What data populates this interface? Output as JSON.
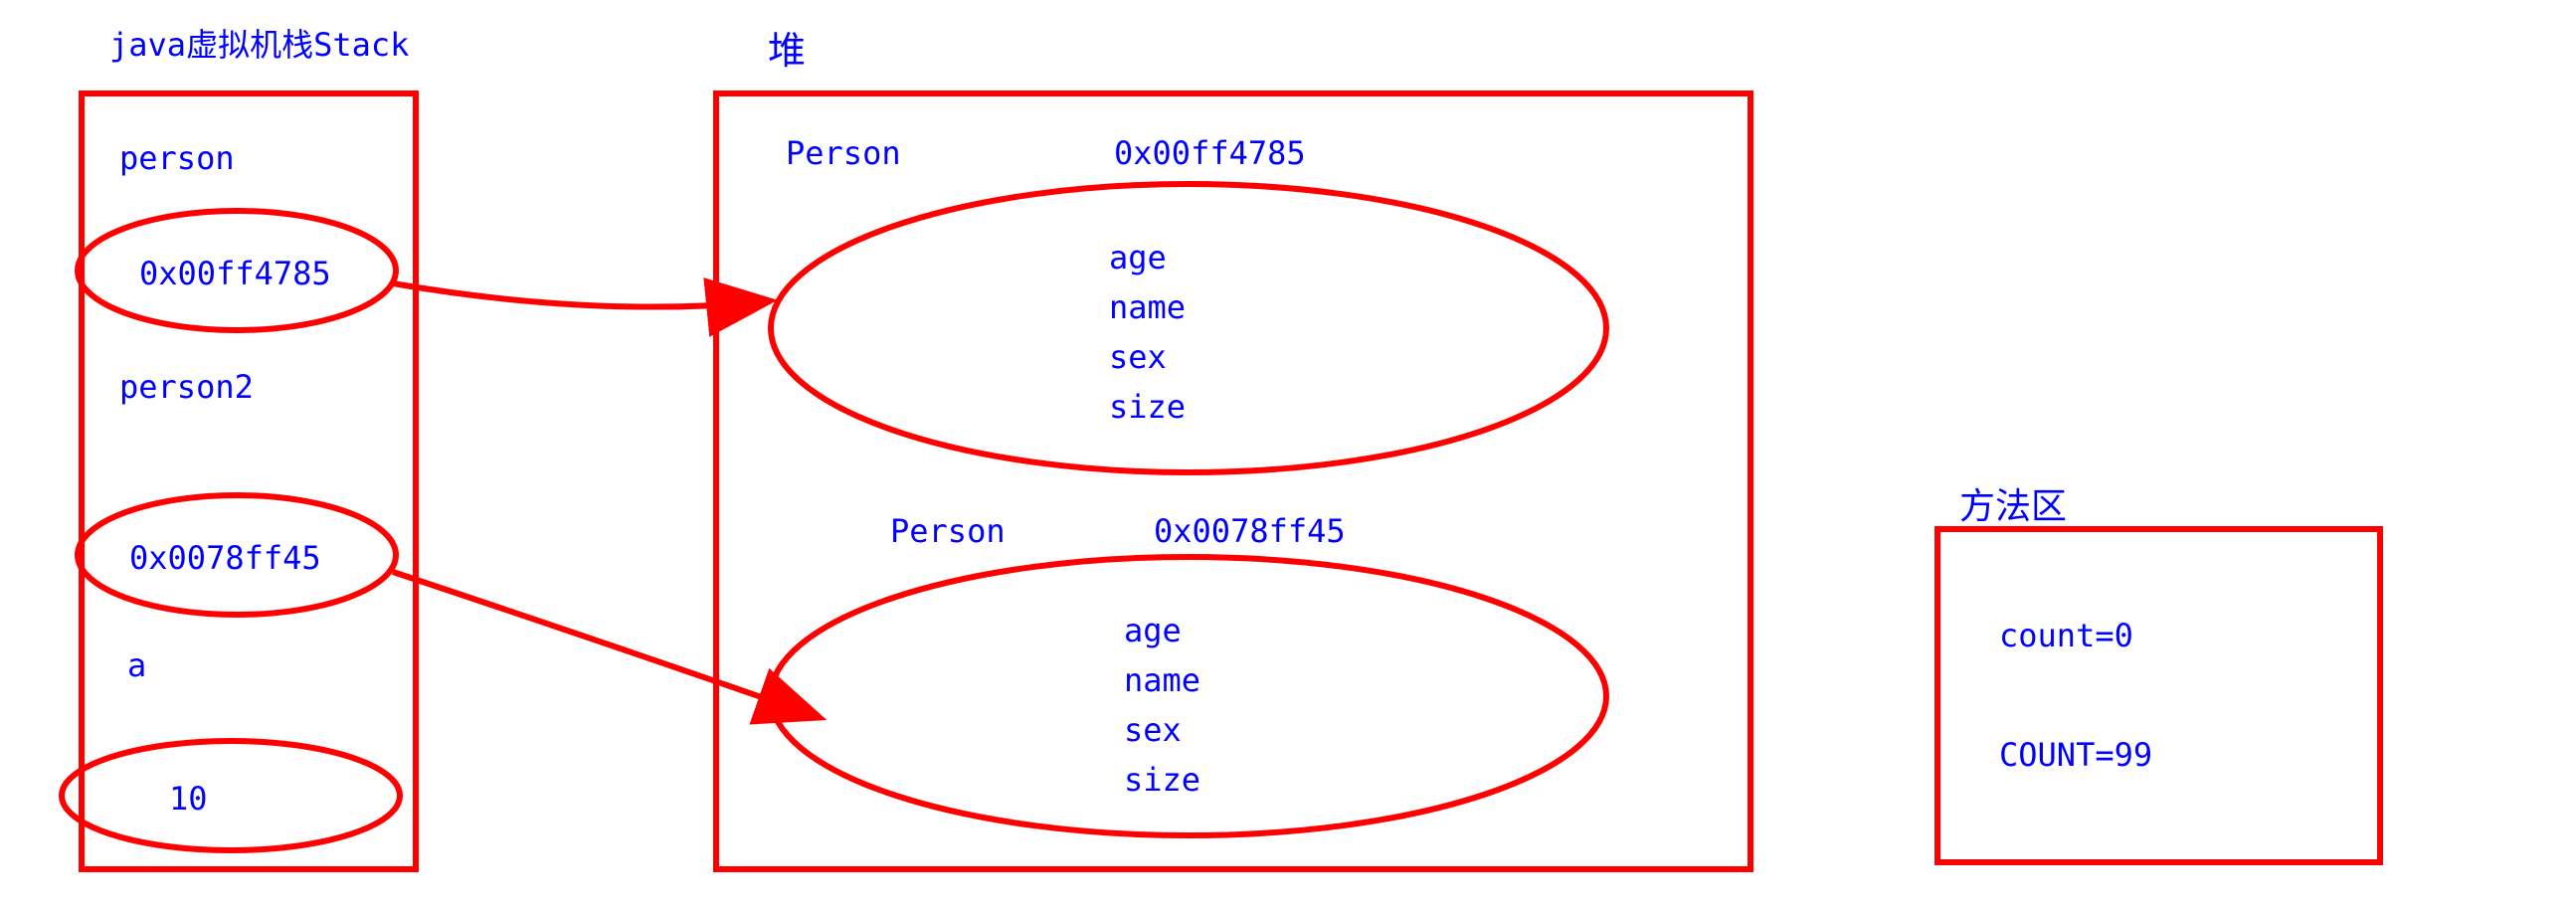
{
  "stack": {
    "title": "java虚拟机栈Stack",
    "items": [
      {
        "label": "person",
        "addr": "0x00ff4785"
      },
      {
        "label": "person2",
        "addr": "0x0078ff45"
      },
      {
        "label": "a",
        "addr": "10"
      }
    ]
  },
  "heap": {
    "title": "堆",
    "objects": [
      {
        "class": "Person",
        "addr": "0x00ff4785",
        "fields": [
          "age",
          "name",
          "sex",
          "size"
        ]
      },
      {
        "class": "Person",
        "addr": "0x0078ff45",
        "fields": [
          "age",
          "name",
          "sex",
          "size"
        ]
      }
    ]
  },
  "method_area": {
    "title": "方法区",
    "entries": [
      "count=0",
      "COUNT=99"
    ]
  },
  "colors": {
    "stroke": "#ff0000",
    "text": "#0000ff"
  }
}
